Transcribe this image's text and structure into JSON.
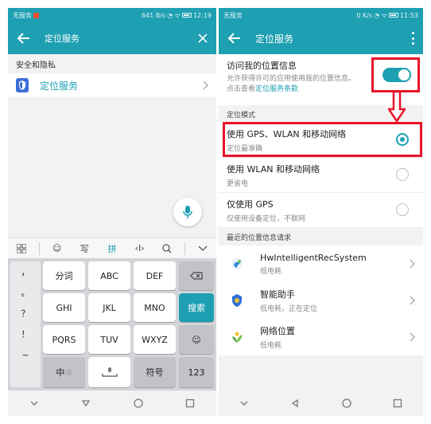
{
  "left": {
    "status": {
      "carrier": "无服务",
      "speed": "641 B/s",
      "time": "12:19"
    },
    "search": {
      "query": "定位服务"
    },
    "section_title": "安全和隐私",
    "result": {
      "label": "定位服务"
    },
    "toolbar": {
      "write": "写",
      "pinyin": "拼"
    },
    "keys": {
      "punct": [
        "，",
        "。",
        "？",
        "！",
        "~"
      ],
      "r1": [
        "分词",
        "ABC",
        "DEF"
      ],
      "r2": [
        "GHI",
        "JKL",
        "MNO"
      ],
      "search": "搜索",
      "r3": [
        "PQRS",
        "TUV",
        "WXYZ"
      ],
      "zh": "中",
      "zh_sub": "/英",
      "fuhao": "符号",
      "num": "123"
    }
  },
  "right": {
    "status": {
      "carrier": "无服务",
      "speed": "0 K/s",
      "time": "11:53"
    },
    "title": "定位服务",
    "access": {
      "title": "访问我的位置信息",
      "desc": "允许获得许可的应用使用我的位置信息。点击查看",
      "link": "定位服务条款"
    },
    "mode_header": "定位模式",
    "modes": [
      {
        "title": "使用 GPS、WLAN 和移动网络",
        "sub": "定位最准确",
        "checked": true
      },
      {
        "title": "使用 WLAN 和移动网络",
        "sub": "更省电",
        "checked": false
      },
      {
        "title": "仅使用 GPS",
        "sub": "仅使用设备定位，不联网",
        "checked": false
      }
    ],
    "recent_header": "最近的位置信息请求",
    "apps": [
      {
        "name": "HwIntelligentRecSystem",
        "sub": "低电耗"
      },
      {
        "name": "智能助手",
        "sub": "低电耗，正在定位"
      },
      {
        "name": "网络位置",
        "sub": "低电耗"
      }
    ]
  },
  "colors": {
    "accent": "#1e9fb2",
    "highlight": "#e8132a"
  }
}
